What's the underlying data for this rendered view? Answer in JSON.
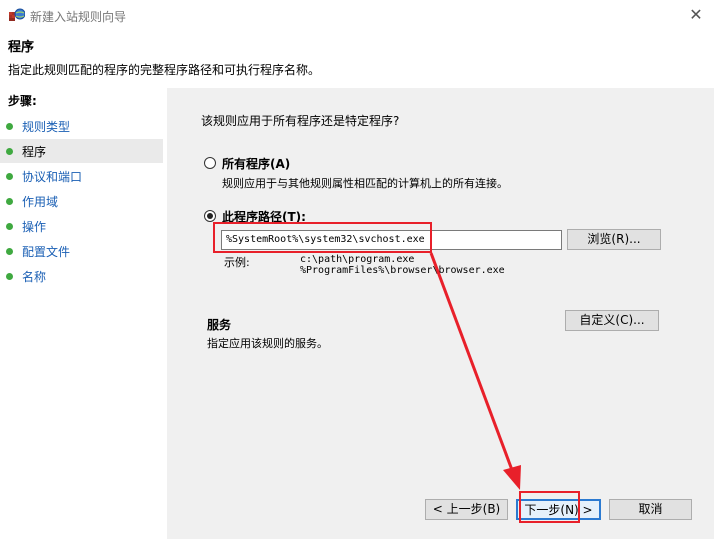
{
  "window": {
    "title": "新建入站规则向导",
    "close_glyph": "✕"
  },
  "header": {
    "title": "程序",
    "subtitle": "指定此规则匹配的程序的完整程序路径和可执行程序名称。"
  },
  "sidebar": {
    "title": "步骤:",
    "items": [
      {
        "label": "规则类型",
        "active": false
      },
      {
        "label": "程序",
        "active": true
      },
      {
        "label": "协议和端口",
        "active": false
      },
      {
        "label": "作用域",
        "active": false
      },
      {
        "label": "操作",
        "active": false
      },
      {
        "label": "配置文件",
        "active": false
      },
      {
        "label": "名称",
        "active": false
      }
    ]
  },
  "main": {
    "question": "该规则应用于所有程序还是特定程序?",
    "all_programs": {
      "label": "所有程序(A)",
      "description": "规则应用于与其他规则属性相匹配的计算机上的所有连接。",
      "selected": false
    },
    "program_path": {
      "label": "此程序路径(T):",
      "selected": true,
      "value": "%SystemRoot%\\system32\\svchost.exe",
      "browse_label": "浏览(R)...",
      "example_label": "示例:",
      "example_line1": "c:\\path\\program.exe",
      "example_line2": "%ProgramFiles%\\browser\\browser.exe"
    },
    "services": {
      "title": "服务",
      "description": "指定应用该规则的服务。",
      "customize_label": "自定义(C)..."
    }
  },
  "footer": {
    "back_label": "< 上一步(B)",
    "next_label": "下一步(N) >",
    "cancel_label": "取消"
  },
  "annotations": {
    "highlight_color": "#e8202a"
  }
}
